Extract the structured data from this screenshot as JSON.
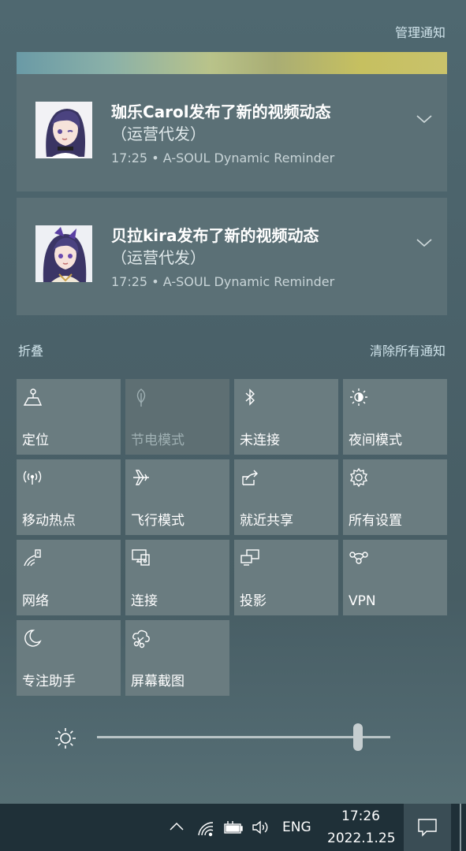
{
  "header": {
    "manage_label": "管理通知"
  },
  "notifications": [
    {
      "title": "珈乐Carol发布了新的视频动态",
      "subtitle": "（运营代发）",
      "meta": "17:25 • A-SOUL Dynamic Reminder",
      "avatar_icon": "carol-avatar"
    },
    {
      "title": "贝拉kira发布了新的视频动态",
      "subtitle": "（运营代发）",
      "meta": "17:25 • A-SOUL Dynamic Reminder",
      "avatar_icon": "kira-avatar"
    }
  ],
  "actions": {
    "collapse_label": "折叠",
    "clear_all_label": "清除所有通知"
  },
  "quick_actions": [
    {
      "label": "定位",
      "icon": "location-icon",
      "enabled": true
    },
    {
      "label": "节电模式",
      "icon": "leaf-icon",
      "enabled": false
    },
    {
      "label": "未连接",
      "icon": "bluetooth-icon",
      "enabled": true
    },
    {
      "label": "夜间模式",
      "icon": "night-light-icon",
      "enabled": true
    },
    {
      "label": "移动热点",
      "icon": "hotspot-icon",
      "enabled": true
    },
    {
      "label": "飞行模式",
      "icon": "airplane-icon",
      "enabled": true
    },
    {
      "label": "就近共享",
      "icon": "nearby-share-icon",
      "enabled": true
    },
    {
      "label": "所有设置",
      "icon": "gear-icon",
      "enabled": true
    },
    {
      "label": "网络",
      "icon": "network-icon",
      "enabled": true
    },
    {
      "label": "连接",
      "icon": "connect-icon",
      "enabled": true
    },
    {
      "label": "投影",
      "icon": "project-icon",
      "enabled": true
    },
    {
      "label": "VPN",
      "icon": "vpn-icon",
      "enabled": true
    },
    {
      "label": "专注助手",
      "icon": "moon-icon",
      "enabled": true
    },
    {
      "label": "屏幕截图",
      "icon": "snip-icon",
      "enabled": true
    }
  ],
  "brightness": {
    "level": 0.89,
    "icon": "sun-icon"
  },
  "taskbar": {
    "language": "ENG",
    "time": "17:26",
    "date": "2022.1.25",
    "icons": [
      "chevron-up-icon",
      "wifi-icon",
      "battery-icon",
      "volume-icon",
      "action-center-icon"
    ]
  },
  "colors": {
    "panel_bg": "#4b6169",
    "tile_bg": "#6a7c80",
    "notif_bg": "#5b7076",
    "taskbar_bg": "#1f3038",
    "link": "#cfe3ea"
  }
}
